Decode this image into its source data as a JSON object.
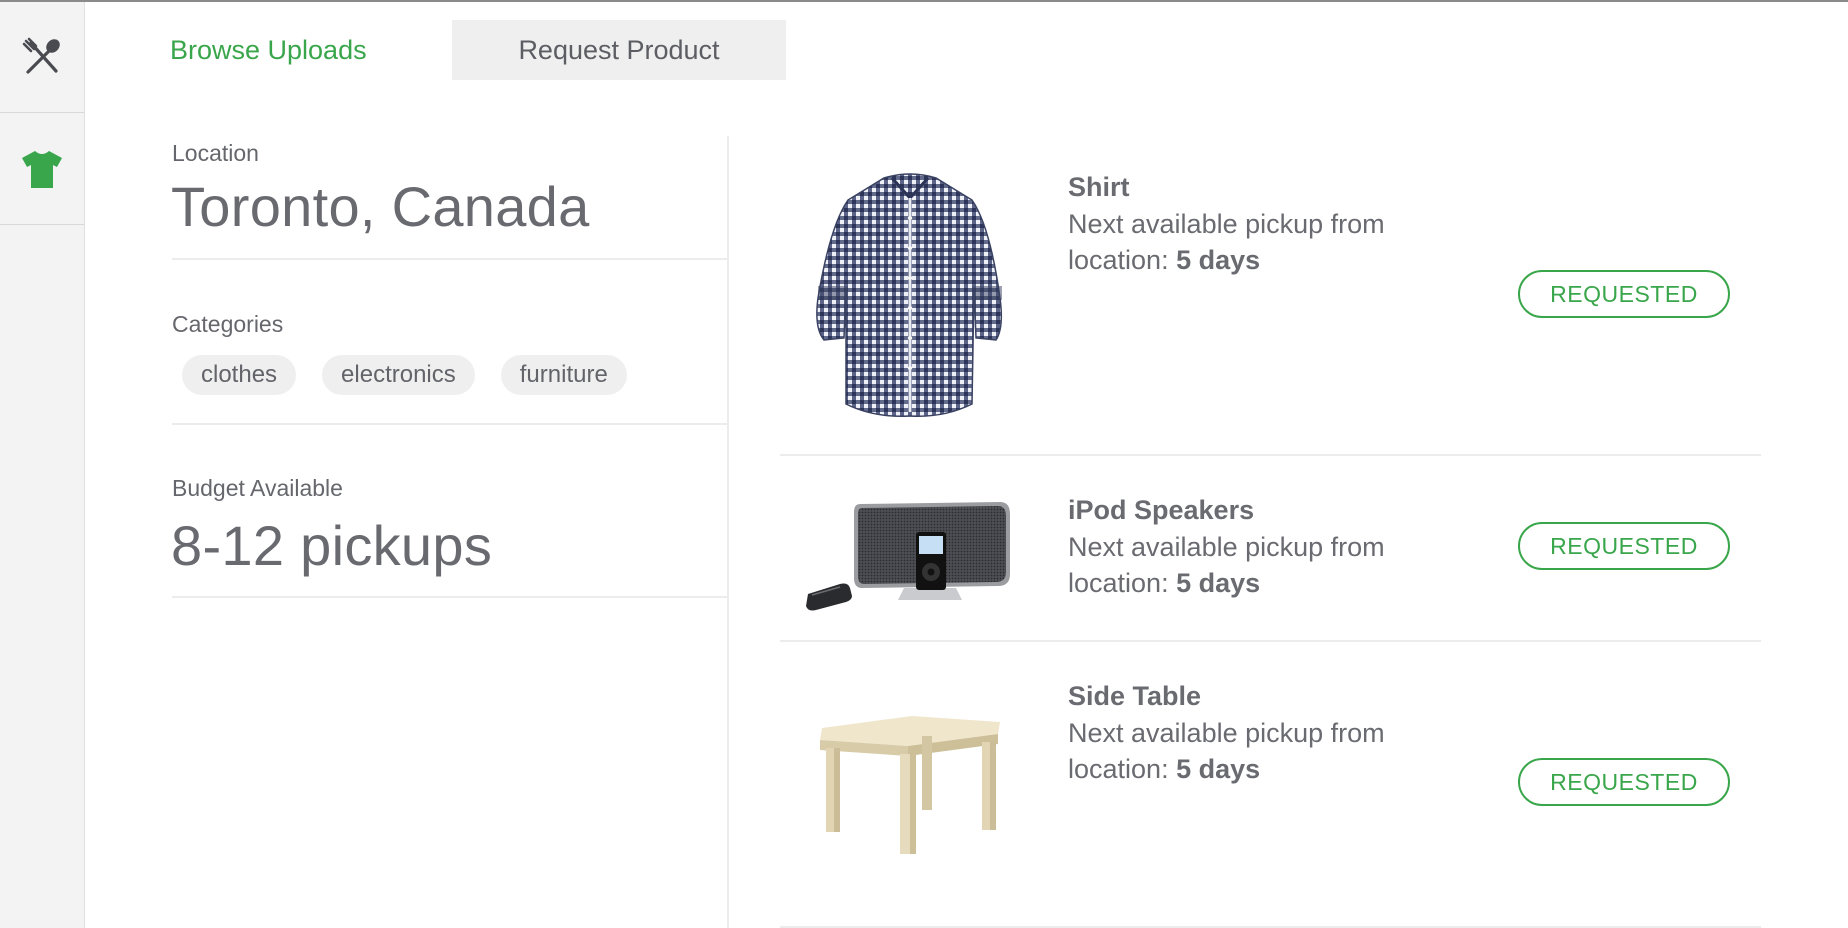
{
  "colors": {
    "accent": "#3aa64b",
    "text": "#6a6b71",
    "sidebar_bg": "#f3f3f3",
    "chip_bg": "#efefef"
  },
  "sidebar": {
    "items": [
      {
        "icon": "utensils-icon",
        "active": false
      },
      {
        "icon": "tshirt-icon",
        "active": true
      }
    ]
  },
  "tabs": [
    {
      "label": "Browse Uploads",
      "active": true
    },
    {
      "label": "Request Product",
      "active": false
    }
  ],
  "filters": {
    "location": {
      "label": "Location",
      "value": "Toronto, Canada"
    },
    "categories": {
      "label": "Categories",
      "items": [
        "clothes",
        "electronics",
        "furniture"
      ]
    },
    "budget": {
      "label": "Budget Available",
      "value": "8-12 pickups"
    }
  },
  "products": [
    {
      "title": "Shirt",
      "desc_prefix": "Next available pickup from location:",
      "days": "5 days",
      "button": "REQUESTED",
      "image": "shirt-image"
    },
    {
      "title": "iPod Speakers",
      "desc_prefix": "Next available pickup from location:",
      "days": "5 days",
      "button": "REQUESTED",
      "image": "ipod-speakers-image"
    },
    {
      "title": "Side Table",
      "desc_prefix": "Next available pickup from location:",
      "days": "5 days",
      "button": "REQUESTED",
      "image": "side-table-image"
    }
  ]
}
